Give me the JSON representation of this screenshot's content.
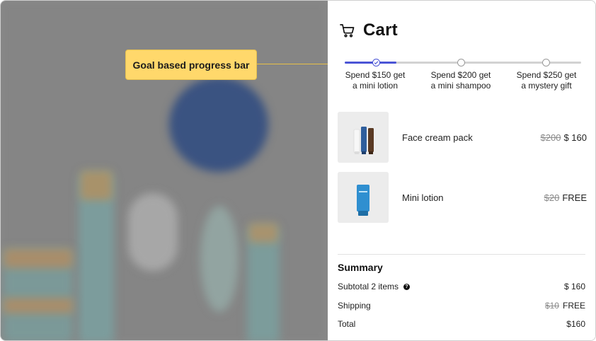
{
  "annotation": {
    "label": "Goal based progress bar"
  },
  "cart": {
    "title": "Cart",
    "icon": "cart-icon",
    "progress": {
      "value": 0.22,
      "accent": "#4b55d6",
      "milestones": [
        {
          "line1": "Spend $150 get",
          "line2": "a mini lotion",
          "reached": true
        },
        {
          "line1": "Spend $200 get",
          "line2": "a mini shampoo",
          "reached": false
        },
        {
          "line1": "Spend $250 get",
          "line2": "a mystery gift",
          "reached": false
        }
      ]
    },
    "items": [
      {
        "name": "Face cream pack",
        "old_price": "$200",
        "price": "$ 160",
        "image": "face-cream-pack-image"
      },
      {
        "name": "Mini lotion",
        "old_price": "$20",
        "price": "FREE",
        "image": "mini-lotion-image"
      }
    ],
    "summary": {
      "title": "Summary",
      "subtotal_label": "Subtotal 2 items",
      "subtotal_help": "?",
      "subtotal_value": "$ 160",
      "shipping_label": "Shipping",
      "shipping_old": "$10",
      "shipping_value": "FREE",
      "total_label": "Total",
      "total_value": "$160"
    }
  },
  "colors": {
    "annotation_bg": "#ffd86b",
    "overlay": "#8a8a8a"
  }
}
